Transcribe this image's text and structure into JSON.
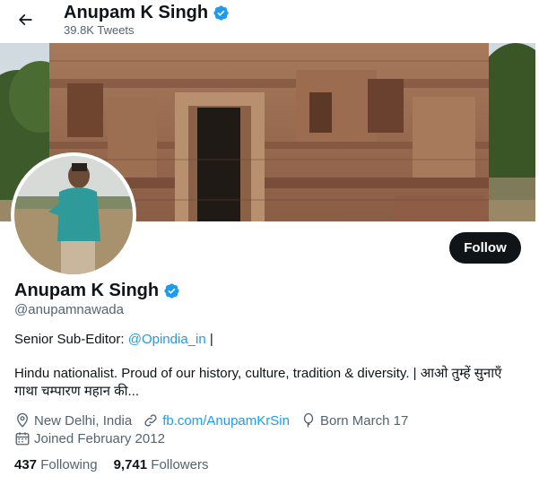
{
  "header": {
    "name": "Anupam K Singh",
    "tweet_count": "39.8K Tweets"
  },
  "profile": {
    "name": "Anupam K Singh",
    "handle": "@anupamnawada",
    "follow_label": "Follow",
    "bio": {
      "line1_prefix": "Senior Sub-Editor: ",
      "line1_link": "@Opindia_in",
      "line1_suffix": " |",
      "line2": "Hindu nationalist. Proud of our history, culture, tradition & diversity. | आओ तुम्हें सुनाएँ गाथा चम्पारण महान की..."
    },
    "location": "New Delhi, India",
    "website": "fb.com/AnupamKrSin",
    "birthday": "Born March 17",
    "joined": "Joined February 2012",
    "following_count": "437",
    "following_label": "Following",
    "followers_count": "9,741",
    "followers_label": "Followers"
  },
  "colors": {
    "accent": "#1d9bf0",
    "text_primary": "#0f1419",
    "text_secondary": "#536471"
  },
  "icons": [
    "back-arrow-icon",
    "verified-badge-icon",
    "location-pin-icon",
    "link-icon",
    "balloon-icon",
    "calendar-icon"
  ]
}
